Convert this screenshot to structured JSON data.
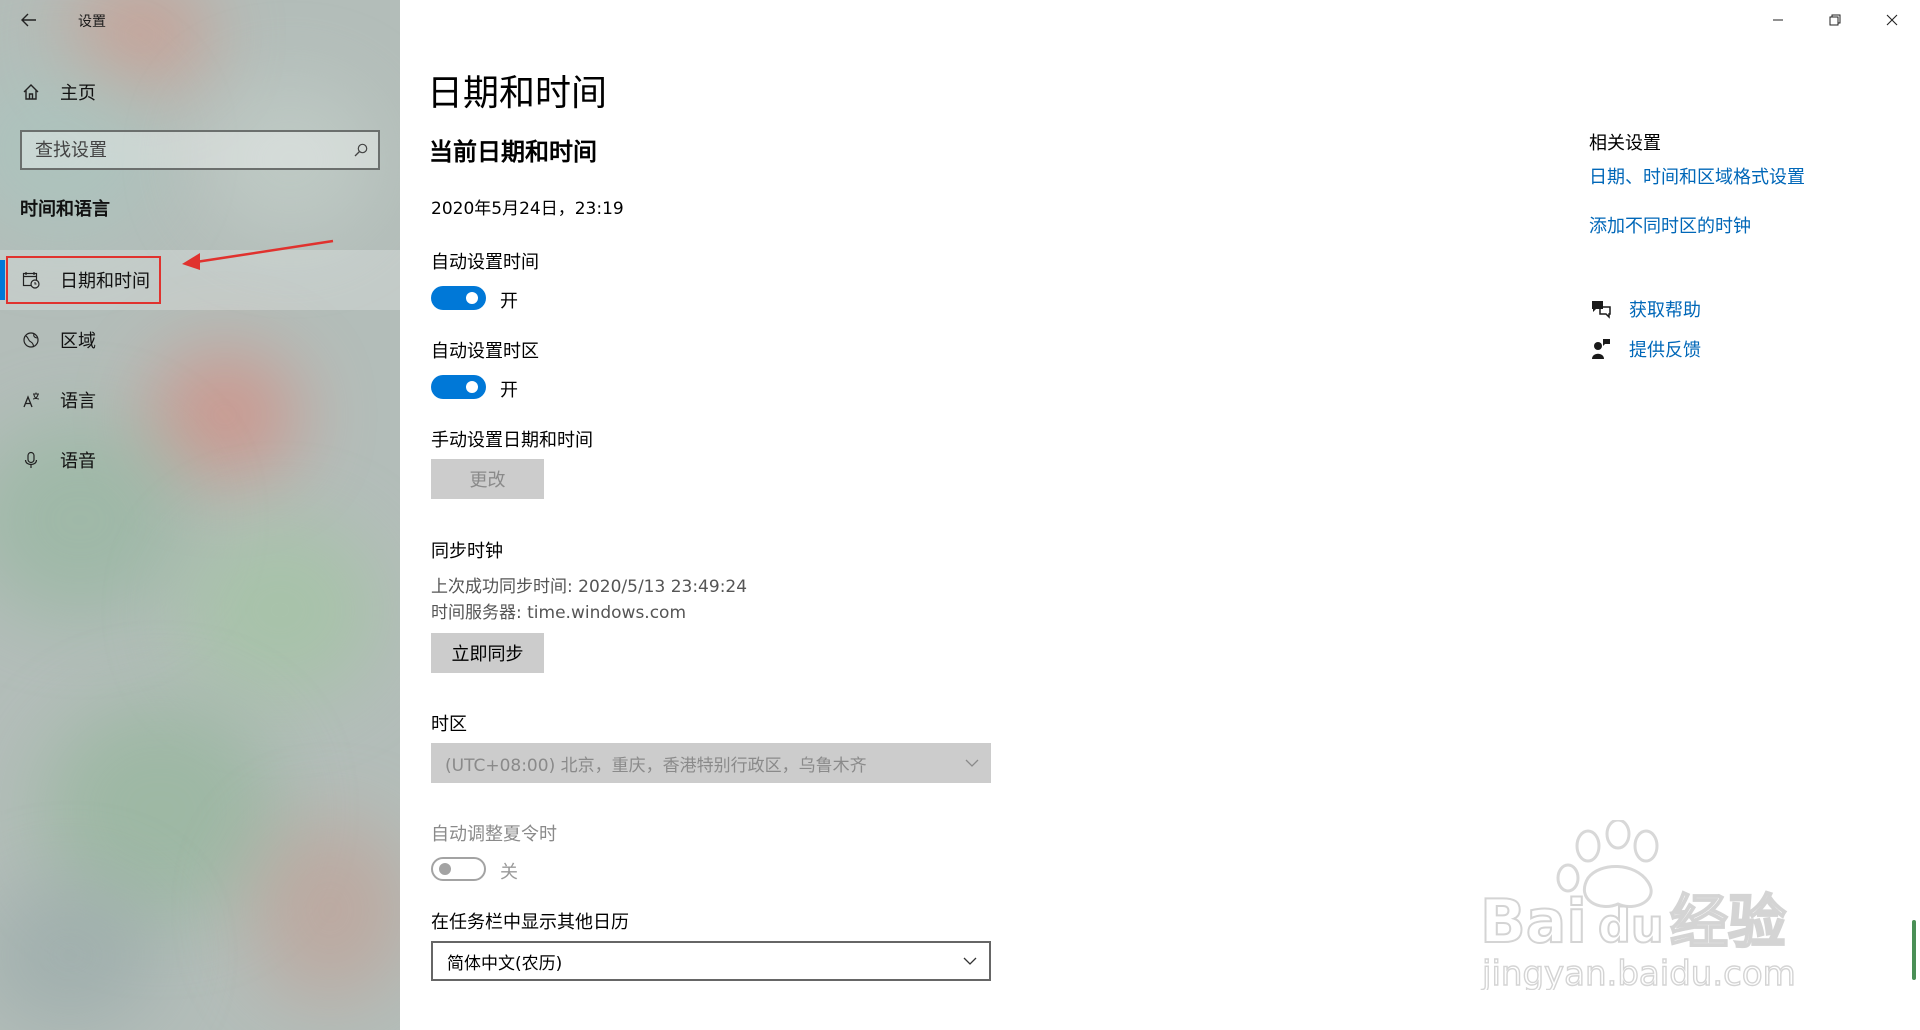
{
  "window": {
    "title": "设置",
    "controls": {
      "minimize": "minimize-icon",
      "restore": "restore-icon",
      "close": "close-icon"
    }
  },
  "sidebar": {
    "home_label": "主页",
    "search_placeholder": "查找设置",
    "section_title": "时间和语言",
    "items": [
      {
        "label": "日期和时间",
        "icon": "calendar-clock-icon",
        "selected": true
      },
      {
        "label": "区域",
        "icon": "globe-icon",
        "selected": false
      },
      {
        "label": "语言",
        "icon": "language-icon",
        "selected": false
      },
      {
        "label": "语音",
        "icon": "microphone-icon",
        "selected": false
      }
    ]
  },
  "main": {
    "page_title": "日期和时间",
    "subtitle": "当前日期和时间",
    "current_datetime": "2020年5月24日，23:19",
    "auto_time": {
      "label": "自动设置时间",
      "state": "开",
      "on": true
    },
    "auto_timezone": {
      "label": "自动设置时区",
      "state": "开",
      "on": true
    },
    "manual": {
      "label": "手动设置日期和时间",
      "button": "更改"
    },
    "sync": {
      "label": "同步时钟",
      "last_sync": "上次成功同步时间: 2020/5/13 23:49:24",
      "server": "时间服务器: time.windows.com",
      "button": "立即同步"
    },
    "timezone": {
      "label": "时区",
      "value": "(UTC+08:00) 北京，重庆，香港特别行政区，乌鲁木齐"
    },
    "dst": {
      "label": "自动调整夏令时",
      "state": "关",
      "on": false
    },
    "calendar": {
      "label": "在任务栏中显示其他日历",
      "value": "简体中文(农历)"
    }
  },
  "related": {
    "title": "相关设置",
    "links": [
      "日期、时间和区域格式设置",
      "添加不同时区的时钟"
    ],
    "help": "获取帮助",
    "feedback": "提供反馈"
  },
  "watermark": {
    "brand": "Bai",
    "brand2": "du",
    "cn": "经验",
    "url": "jingyan.baidu.com"
  },
  "colors": {
    "accent": "#0078d7",
    "link": "#0067b8",
    "highlight": "#e0322e"
  }
}
